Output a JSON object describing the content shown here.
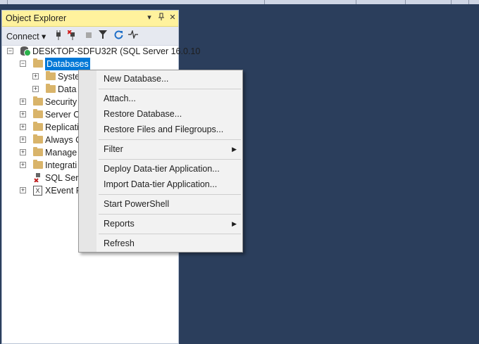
{
  "panel": {
    "title": "Object Explorer",
    "titlebar_buttons": [
      "▾",
      "⊥",
      "✕"
    ],
    "toolbar": {
      "connect_label": "Connect ▾"
    }
  },
  "tree": {
    "server": "DESKTOP-SDFU32R (SQL Server 16.0.10",
    "databases": "Databases",
    "system": "Syste",
    "data": "Data",
    "security": "Security",
    "server_objects": "Server O",
    "replication": "Replicati",
    "always_on": "Always C",
    "management": "Manage",
    "integration": "Integrati",
    "sql_agent": "SQL Serv",
    "xevent": "XEvent P"
  },
  "menu": {
    "new_database": "New Database...",
    "attach": "Attach...",
    "restore_database": "Restore Database...",
    "restore_files": "Restore Files and Filegroups...",
    "filter": "Filter",
    "deploy_dac": "Deploy Data-tier Application...",
    "import_dac": "Import Data-tier Application...",
    "start_powershell": "Start PowerShell",
    "reports": "Reports",
    "refresh": "Refresh",
    "submenu_arrow": "▶"
  },
  "colors": {
    "background": "#2b3e5c",
    "titlebar": "#fff29d",
    "selection": "#0078d7"
  }
}
